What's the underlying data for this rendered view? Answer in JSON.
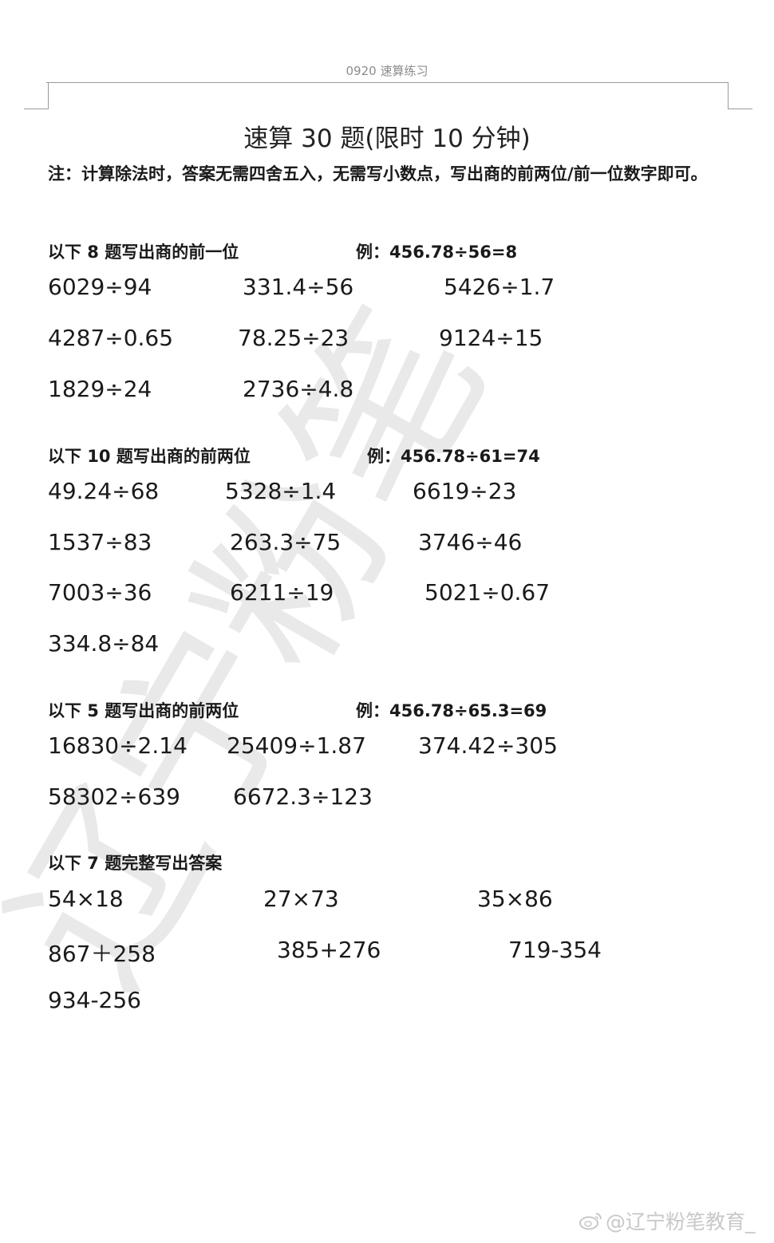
{
  "header": {
    "text": "0920 速算练习"
  },
  "title": "速算 30 题(限时 10 分钟)",
  "note": "注：计算除法时，答案无需四舍五入，无需写小数点，写出商的前两位/前一位数字即可。",
  "sections": [
    {
      "label": "以下 8 题写出商的前一位",
      "example": "例：456.78÷56=8",
      "questions": [
        "6029÷94",
        "331.4÷56",
        "5426÷1.7",
        "4287÷0.65",
        "78.25÷23",
        "9124÷15",
        "1829÷24",
        "2736÷4.8"
      ]
    },
    {
      "label": "以下 10 题写出商的前两位",
      "example": "例：456.78÷61=74",
      "questions": [
        "49.24÷68",
        "5328÷1.4",
        "6619÷23",
        "1537÷83",
        "263.3÷75",
        "3746÷46",
        "7003÷36",
        "6211÷19",
        "5021÷0.67",
        "334.8÷84"
      ]
    },
    {
      "label": "以下 5 题写出商的前两位",
      "example": "例：456.78÷65.3=69",
      "questions": [
        "16830÷2.14",
        "25409÷1.87",
        "374.42÷305",
        "58302÷639",
        "6672.3÷123"
      ]
    },
    {
      "label": "以下 7 题完整写出答案",
      "example": "",
      "questions": [
        "54×18",
        "27×73",
        "35×86",
        "867＋258",
        "385+276",
        "719-354",
        "934-256"
      ]
    }
  ],
  "watermark": {
    "text": "辽宁粉笔"
  },
  "footer": {
    "text": "@辽宁粉笔教育_",
    "icon": "weibo-icon"
  }
}
